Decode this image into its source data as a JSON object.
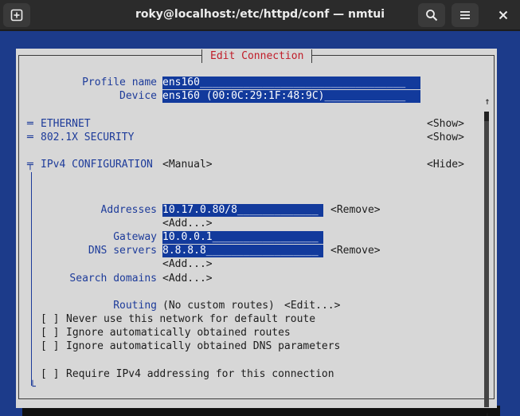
{
  "window": {
    "title": "roky@localhost:/etc/httpd/conf — nmtui"
  },
  "dialog": {
    "title": "Edit Connection",
    "profile_name": {
      "label": "Profile name",
      "value": "ens160_________________________________"
    },
    "device": {
      "label": "Device",
      "value": "ens160 (00:0C:29:1F:48:9C)_____________"
    },
    "sections": {
      "ethernet": {
        "marker": "═",
        "label": "ETHERNET",
        "action": "<Show>"
      },
      "security": {
        "marker": "═",
        "label": "802.1X SECURITY",
        "action": "<Show>"
      },
      "ipv4": {
        "marker": "╤",
        "label": "IPv4 CONFIGURATION",
        "mode": "<Manual>",
        "action": "<Hide>"
      }
    },
    "ipv4": {
      "addresses_label": "Addresses",
      "address_value": "10.17.0.80/8_____________",
      "address_remove": "<Remove>",
      "address_add": "<Add...>",
      "gateway_label": "Gateway",
      "gateway_value": "10.0.0.1_________________",
      "dns_label": "DNS servers",
      "dns_value": "8.8.8.8__________________",
      "dns_remove": "<Remove>",
      "dns_add": "<Add...>",
      "search_label": "Search domains",
      "search_add": "<Add...>",
      "routing_label": "Routing",
      "routing_value": "(No custom routes)",
      "routing_edit": "<Edit...>",
      "checkboxes": [
        {
          "box": "[ ]",
          "label": "Never use this network for default route"
        },
        {
          "box": "[ ]",
          "label": "Ignore automatically obtained routes"
        },
        {
          "box": "[ ]",
          "label": "Ignore automatically obtained DNS parameters"
        },
        {
          "box": "[ ]",
          "label": "Require IPv4 addressing for this connection"
        }
      ],
      "end_marker": "└"
    },
    "scrollbar": {
      "up": "↑",
      "down": "↓"
    }
  },
  "icons": {
    "new_tab": "new-tab-icon",
    "search": "search-icon",
    "menu": "hamburger-menu-icon",
    "close": "close-icon"
  },
  "colors": {
    "terminal_bg": "#1c3b8a",
    "dialog_bg": "#d7d7d7",
    "field_bg": "#123a9c",
    "title_red": "#c01c28",
    "label_blue": "#1d3b9a"
  }
}
